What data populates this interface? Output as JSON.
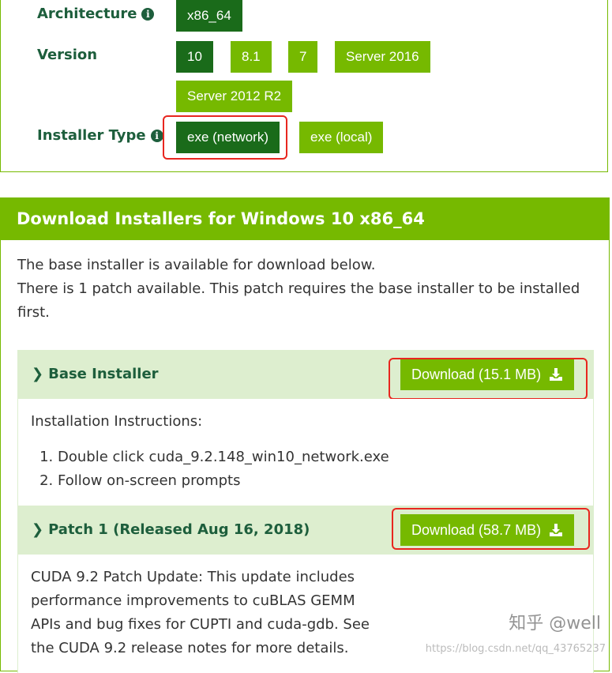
{
  "selector": {
    "architecture": {
      "label": "Architecture",
      "options": [
        "x86_64"
      ],
      "selected": "x86_64"
    },
    "version": {
      "label": "Version",
      "options": [
        "10",
        "8.1",
        "7",
        "Server 2016",
        "Server 2012 R2"
      ],
      "selected": "10"
    },
    "installer_type": {
      "label": "Installer Type",
      "options": [
        "exe (network)",
        "exe (local)"
      ],
      "selected": "exe (network)"
    },
    "info_glyph": "i"
  },
  "download": {
    "header": "Download Installers for Windows 10 x86_64",
    "intro_line1": "The base installer is available for download below.",
    "intro_line2": "There is 1 patch available. This patch requires the base installer to be installed",
    "intro_line3": "first.",
    "base": {
      "title": "Base Installer",
      "button": "Download (15.1 MB)",
      "instructions_heading": "Installation Instructions:",
      "steps": [
        "Double click cuda_9.2.148_win10_network.exe",
        "Follow on-screen prompts"
      ]
    },
    "patch": {
      "title": "Patch 1 (Released Aug 16, 2018)",
      "button": "Download (58.7 MB)",
      "desc1": "CUDA 9.2 Patch Update: This update includes",
      "desc2": "performance improvements to cuBLAS GEMM",
      "desc3": "APIs and bug fixes for CUPTI and cuda-gdb. See",
      "desc4": "the CUDA 9.2 release notes for more details."
    }
  },
  "watermark": {
    "text": "知乎 @well",
    "url": "https://blog.csdn.net/qq_43765237"
  },
  "colors": {
    "nvidia_green": "#76b900",
    "selected_green": "#1a6b1a",
    "highlight_red": "#e8261f",
    "label_green": "#1d5e3c"
  }
}
